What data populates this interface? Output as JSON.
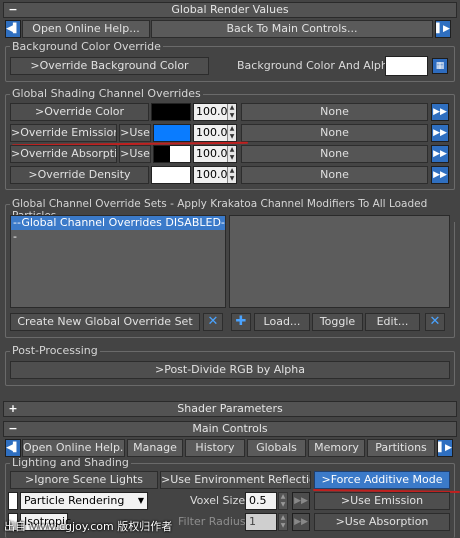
{
  "global_render": {
    "title": "Global Render Values",
    "open_help": "Open Online Help...",
    "back_main": "Back To Main Controls...",
    "bg_group": "Background Color Override",
    "override_bg_btn": ">Override Background Color",
    "bg_color_label": "Background Color And Alpha:",
    "shading_group": "Global Shading Channel Overrides",
    "rows": [
      {
        "label": ">Override Color",
        "use": "",
        "swatch": "#000000",
        "value": "100.0",
        "map": "None"
      },
      {
        "label": ">Override Emission",
        "use": ">Use",
        "swatch": "#0a7cff",
        "value": "100.0",
        "map": "None"
      },
      {
        "label": ">Override Absorption",
        "use": ">Use",
        "swatch": "#ffffff",
        "value": "100.0",
        "map": "None"
      },
      {
        "label": ">Override Density",
        "use": "",
        "swatch": "#ffffff",
        "value": "100.0",
        "map": "None"
      }
    ],
    "sets_group": "Global Channel Override Sets - Apply Krakatoa Channel Modifiers To All Loaded Particles",
    "list_item": "--Global Channel Overrides DISABLED--",
    "create_set": "Create New Global Override Set",
    "load": "Load...",
    "toggle": "Toggle",
    "edit": "Edit...",
    "post_group": "Post-Processing",
    "post_divide": ">Post-Divide RGB by Alpha"
  },
  "shader_params": {
    "title": "Shader Parameters"
  },
  "main_controls": {
    "title": "Main Controls",
    "tabs": [
      "Open Online Help...",
      "Manage",
      "History",
      "Globals",
      "Memory",
      "Partitions"
    ],
    "lighting_group": "Lighting and Shading",
    "ignore_lights": ">Ignore Scene Lights",
    "env_reflections": ">Use Environment Reflections",
    "force_additive": ">Force Additive Mode",
    "render_mode": "Particle Rendering",
    "voxel_label": "Voxel Size:",
    "voxel_value": "0.5",
    "filter_label": "Filter Radius:",
    "filter_value": "1",
    "use_emission": ">Use Emission",
    "use_absorption": ">Use Absorption",
    "phase": "Isotropic"
  },
  "watermark": "出自 www.cgjoy.com 版权归作者"
}
